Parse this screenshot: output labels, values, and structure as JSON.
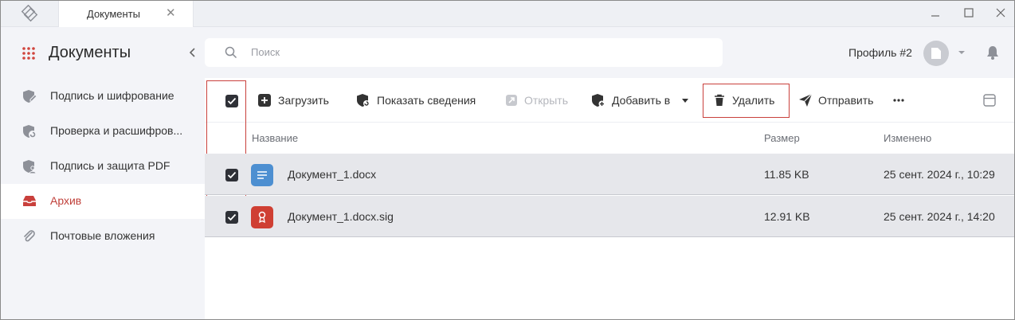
{
  "tab": {
    "title": "Документы"
  },
  "sidebar": {
    "title": "Документы",
    "items": [
      {
        "label": "Подпись и шифрование",
        "icon": "shield-pen-icon"
      },
      {
        "label": "Проверка и расшифров...",
        "icon": "shield-refresh-icon"
      },
      {
        "label": "Подпись и защита PDF",
        "icon": "shield-user-icon"
      },
      {
        "label": "Архив",
        "icon": "archive-icon",
        "active": true
      },
      {
        "label": "Почтовые вложения",
        "icon": "paperclip-icon"
      }
    ]
  },
  "search": {
    "placeholder": "Поиск"
  },
  "profile": {
    "label": "Профиль #2"
  },
  "toolbar": {
    "upload": "Загрузить",
    "show_info": "Показать сведения",
    "open": "Открыть",
    "add_to": "Добавить в",
    "delete": "Удалить",
    "send": "Отправить"
  },
  "table": {
    "columns": {
      "name": "Название",
      "size": "Размер",
      "modified": "Изменено"
    },
    "rows": [
      {
        "name": "Документ_1.docx",
        "size": "11.85 KB",
        "modified": "25 сент. 2024 г., 10:29",
        "icon": "document-file-icon",
        "color": "#4d8fd1",
        "checked": true
      },
      {
        "name": "Документ_1.docx.sig",
        "size": "12.91 KB",
        "modified": "25 сент. 2024 г., 14:20",
        "icon": "signature-file-icon",
        "color": "#cf3f33",
        "checked": true
      }
    ]
  },
  "colors": {
    "accent": "#c0403a",
    "highlight": "#c9403c"
  }
}
